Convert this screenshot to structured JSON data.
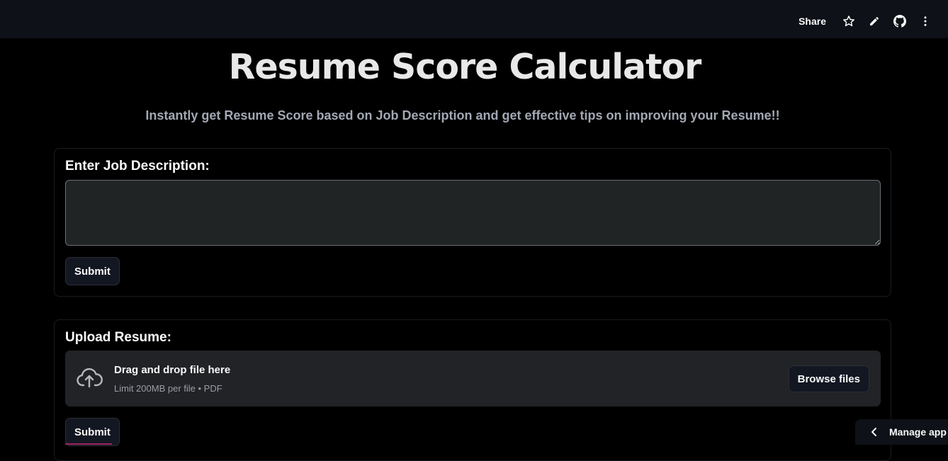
{
  "header": {
    "share_label": "Share",
    "icons": [
      "star-icon",
      "pencil-icon",
      "github-icon",
      "more-vertical-icon"
    ]
  },
  "main": {
    "title": "Resume Score Calculator",
    "subtitle": "Instantly get Resume Score based on Job Description and get effective tips on improving your Resume!!"
  },
  "job_form": {
    "label": "Enter Job Description:",
    "textarea_value": "",
    "submit_label": "Submit"
  },
  "resume_form": {
    "label": "Upload Resume:",
    "dropzone_title": "Drag and drop file here",
    "dropzone_limit": "Limit 200MB per file • PDF",
    "browse_label": "Browse files",
    "submit_label": "Submit"
  },
  "footer": {
    "manage_app_label": "Manage app"
  },
  "colors": {
    "background": "#000000",
    "header_bg": "#0e1117",
    "input_bg": "#212425",
    "button_bg": "#131722"
  }
}
